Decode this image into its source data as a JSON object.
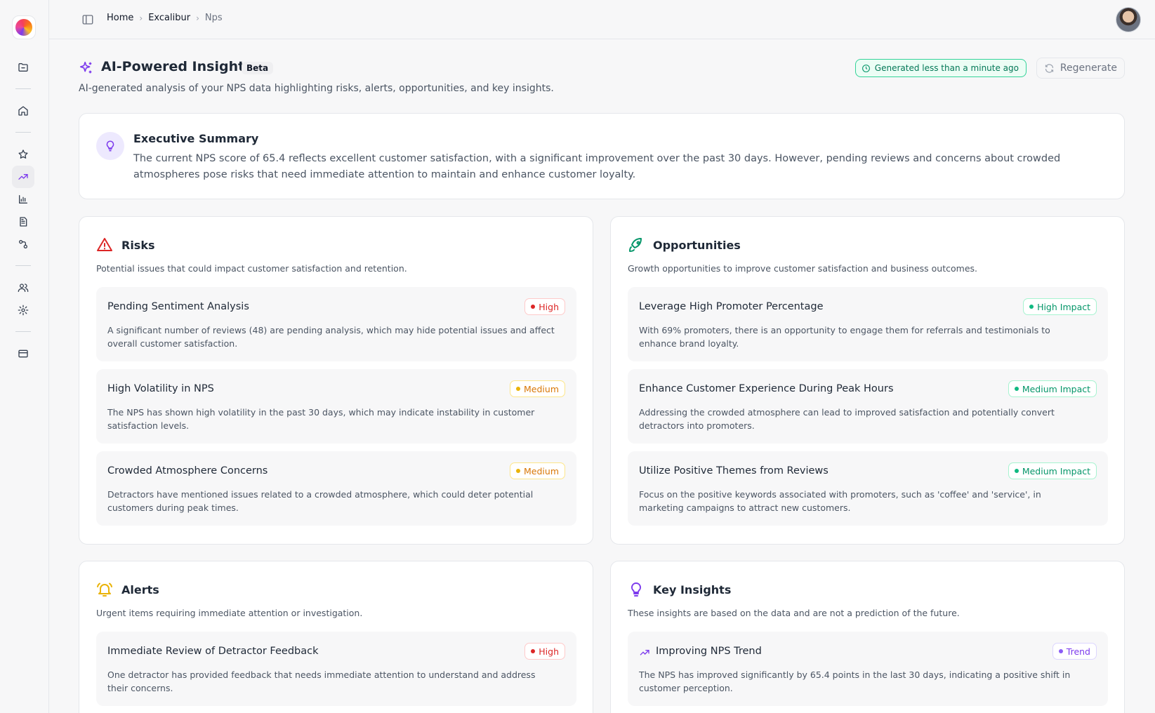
{
  "breadcrumb": {
    "home": "Home",
    "project": "Excalibur",
    "current": "Nps",
    "sep": "›"
  },
  "header": {
    "title": "AI-Powered Insights",
    "beta": "Beta",
    "subtitle": "AI-generated analysis of your NPS data highlighting risks, alerts, opportunities, and key insights.",
    "generated": "Generated less than a minute ago",
    "regenerate": "Regenerate"
  },
  "summary": {
    "title": "Executive Summary",
    "text": "The current NPS score of 65.4 reflects excellent customer satisfaction, with a significant improvement over the past 30 days. However, pending reviews and concerns about crowded atmospheres pose risks that need immediate attention to maintain and enhance customer loyalty."
  },
  "risks": {
    "title": "Risks",
    "desc": "Potential issues that could impact customer satisfaction and retention.",
    "items": [
      {
        "title": "Pending Sentiment Analysis",
        "badge": "High",
        "text": "A significant number of reviews (48) are pending analysis, which may hide potential issues and affect overall customer satisfaction."
      },
      {
        "title": "High Volatility in NPS",
        "badge": "Medium",
        "text": "The NPS has shown high volatility in the past 30 days, which may indicate instability in customer satisfaction levels."
      },
      {
        "title": "Crowded Atmosphere Concerns",
        "badge": "Medium",
        "text": "Detractors have mentioned issues related to a crowded atmosphere, which could deter potential customers during peak times."
      }
    ]
  },
  "opportunities": {
    "title": "Opportunities",
    "desc": "Growth opportunities to improve customer satisfaction and business outcomes.",
    "items": [
      {
        "title": "Leverage High Promoter Percentage",
        "badge": "High Impact",
        "text": "With 69% promoters, there is an opportunity to engage them for referrals and testimonials to enhance brand loyalty."
      },
      {
        "title": "Enhance Customer Experience During Peak Hours",
        "badge": "Medium Impact",
        "text": "Addressing the crowded atmosphere can lead to improved satisfaction and potentially convert detractors into promoters."
      },
      {
        "title": "Utilize Positive Themes from Reviews",
        "badge": "Medium Impact",
        "text": "Focus on the positive keywords associated with promoters, such as 'coffee' and 'service', in marketing campaigns to attract new customers."
      }
    ]
  },
  "alerts": {
    "title": "Alerts",
    "desc": "Urgent items requiring immediate attention or investigation.",
    "items": [
      {
        "title": "Immediate Review of Detractor Feedback",
        "badge": "High",
        "text": "One detractor has provided feedback that needs immediate attention to understand and address their concerns."
      }
    ]
  },
  "insights": {
    "title": "Key Insights",
    "desc": "These insights are based on the data and are not a prediction of the future.",
    "items": [
      {
        "title": "Improving NPS Trend",
        "badge": "Trend",
        "icon": "trending-up-icon",
        "text": "The NPS has improved significantly by 65.4 points in the last 30 days, indicating a positive shift in customer perception."
      }
    ]
  },
  "sidebar": {
    "icons": [
      "folder-icon",
      "home-icon",
      "star-icon",
      "trending-up-icon",
      "bar-chart-icon",
      "document-icon",
      "integrations-icon",
      "users-icon",
      "settings-icon",
      "credit-card-icon"
    ],
    "active": "trending-up-icon"
  },
  "colors": {
    "accent": "#7c3aed",
    "high": "#dc2626",
    "medium": "#d97706",
    "impact": "#059669",
    "generated_badge": "#047857"
  }
}
